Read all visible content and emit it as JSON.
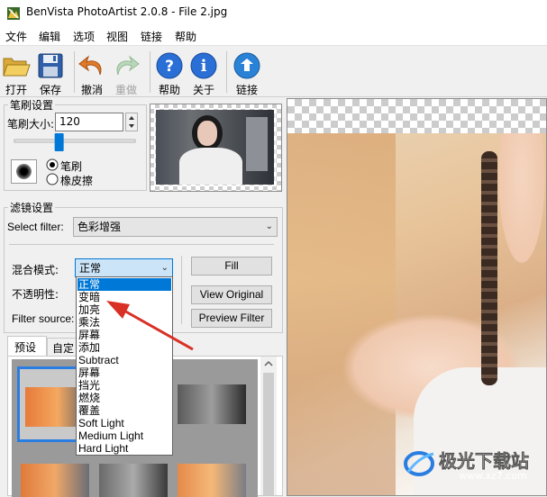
{
  "window": {
    "title": "BenVista PhotoArtist 2.0.8 - File 2.jpg"
  },
  "menu": {
    "items": [
      "文件",
      "编辑",
      "选项",
      "视图",
      "链接",
      "帮助"
    ]
  },
  "toolbar": {
    "open": "打开",
    "save": "保存",
    "undo": "撤消",
    "redo": "重做",
    "help": "帮助",
    "about": "关于",
    "link": "链接"
  },
  "brush": {
    "group_title": "笔刷设置",
    "size_label": "笔刷大小:",
    "size_value": "120",
    "mode_brush": "笔刷",
    "mode_eraser": "橡皮擦",
    "size_fraction": 0.36
  },
  "filter": {
    "group_title": "滤镜设置",
    "select_label": "Select filter:",
    "selected_filter": "色彩增强",
    "blend_label": "混合模式:",
    "blend_value": "正常",
    "opacity_label": "不透明性:",
    "source_label": "Filter source:",
    "fill_button": "Fill",
    "view_original_button": "View Original",
    "preview_filter_button": "Preview Filter"
  },
  "blend_options": [
    "正常",
    "变暗",
    "加亮",
    "乘法",
    "屏幕",
    "添加",
    "Subtract",
    "屏幕",
    "挡光",
    "燃烧",
    "覆盖",
    "Soft Light",
    "Medium Light",
    "Hard Light"
  ],
  "preset_tabs": {
    "presets": "预设",
    "custom": "自定"
  },
  "watermark": {
    "text": "极光下载站",
    "url": "www.xz7.com"
  },
  "colors": {
    "accent": "#0078d7",
    "arrow": "#d93025",
    "preset_border": "#2a7de1"
  }
}
